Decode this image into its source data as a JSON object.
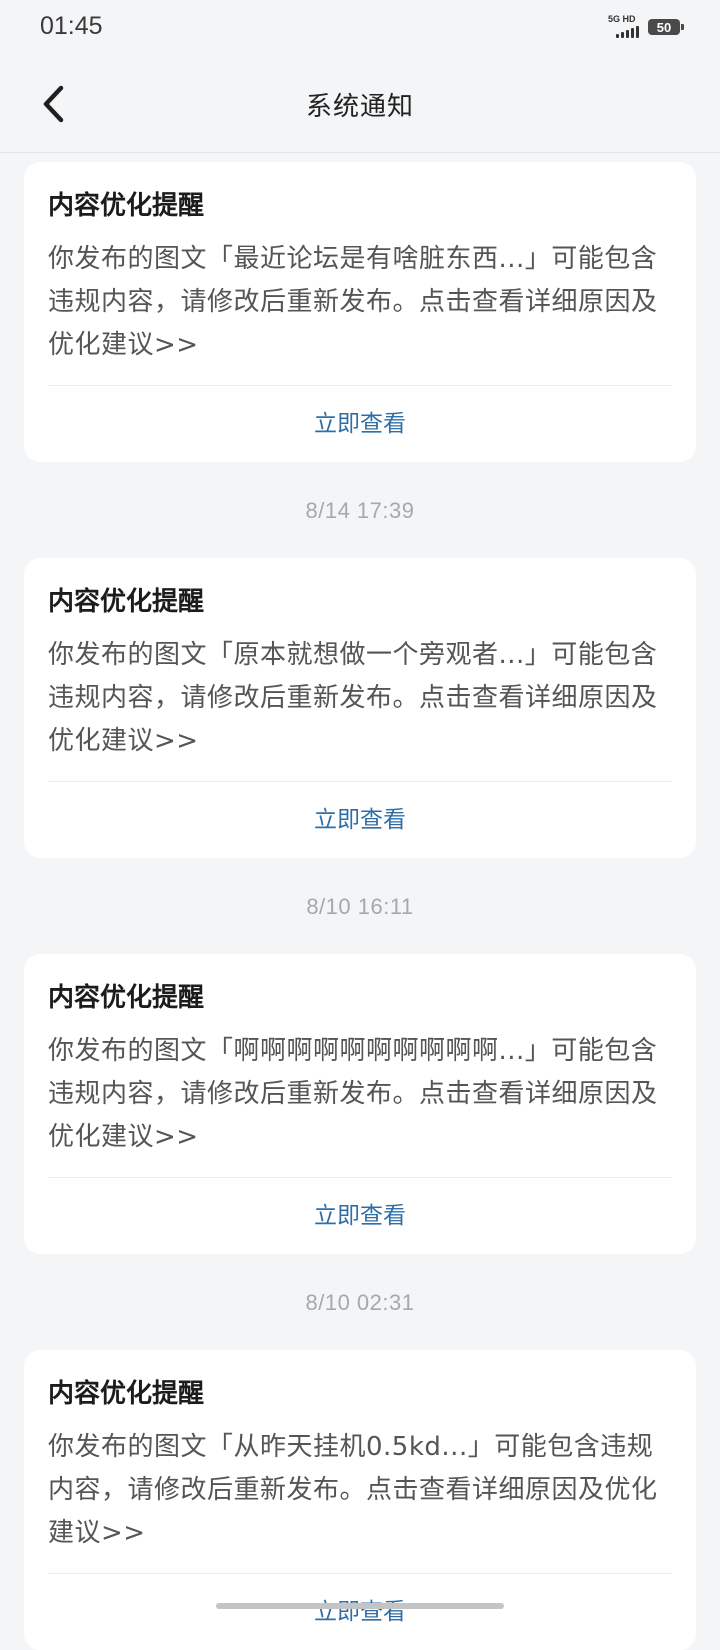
{
  "status_bar": {
    "time": "01:45",
    "network": "5G HD",
    "battery": "50"
  },
  "header": {
    "title": "系统通知"
  },
  "notifications": [
    {
      "timestamp": "",
      "title": "内容优化提醒",
      "body": "你发布的图文「最近论坛是有啥脏东西...」可能包含违规内容，请修改后重新发布。点击查看详细原因及优化建议>>",
      "action": "立即查看"
    },
    {
      "timestamp": "8/14  17:39",
      "title": "内容优化提醒",
      "body": "你发布的图文「原本就想做一个旁观者...」可能包含违规内容，请修改后重新发布。点击查看详细原因及优化建议>>",
      "action": "立即查看"
    },
    {
      "timestamp": "8/10  16:11",
      "title": "内容优化提醒",
      "body": "你发布的图文「啊啊啊啊啊啊啊啊啊啊...」可能包含违规内容，请修改后重新发布。点击查看详细原因及优化建议>>",
      "action": "立即查看"
    },
    {
      "timestamp": "8/10  02:31",
      "title": "内容优化提醒",
      "body": "你发布的图文「从昨天挂机0.5kd...」可能包含违规内容，请修改后重新发布。点击查看详细原因及优化建议>>",
      "action": "立即查看"
    }
  ]
}
